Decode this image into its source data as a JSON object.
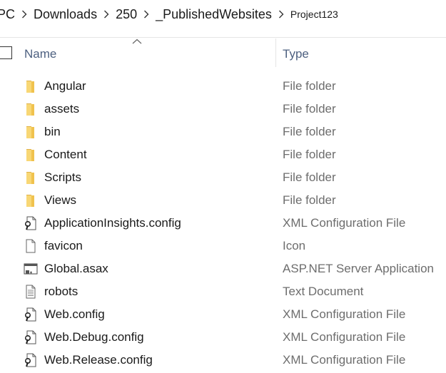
{
  "breadcrumb": [
    "PC",
    "Downloads",
    "250",
    "_PublishedWebsites",
    "Project123"
  ],
  "columns": {
    "name": "Name",
    "type": "Type"
  },
  "files": [
    {
      "name": "Angular",
      "type": "File folder",
      "icon": "folder-icon"
    },
    {
      "name": "assets",
      "type": "File folder",
      "icon": "folder-icon"
    },
    {
      "name": "bin",
      "type": "File folder",
      "icon": "folder-icon"
    },
    {
      "name": "Content",
      "type": "File folder",
      "icon": "folder-icon"
    },
    {
      "name": "Scripts",
      "type": "File folder",
      "icon": "folder-icon"
    },
    {
      "name": "Views",
      "type": "File folder",
      "icon": "folder-icon"
    },
    {
      "name": "ApplicationInsights.config",
      "type": "XML Configuration File",
      "icon": "config-file-icon"
    },
    {
      "name": "favicon",
      "type": "Icon",
      "icon": "blank-file-icon"
    },
    {
      "name": "Global.asax",
      "type": "ASP.NET Server Application",
      "icon": "aspnet-file-icon"
    },
    {
      "name": "robots",
      "type": "Text Document",
      "icon": "text-file-icon"
    },
    {
      "name": "Web.config",
      "type": "XML Configuration File",
      "icon": "config-file-icon"
    },
    {
      "name": "Web.Debug.config",
      "type": "XML Configuration File",
      "icon": "config-file-icon"
    },
    {
      "name": "Web.Release.config",
      "type": "XML Configuration File",
      "icon": "config-file-icon"
    }
  ],
  "colors": {
    "folder": "#f8d775",
    "header_text": "#4d6080",
    "type_text": "#6d6d6d"
  }
}
